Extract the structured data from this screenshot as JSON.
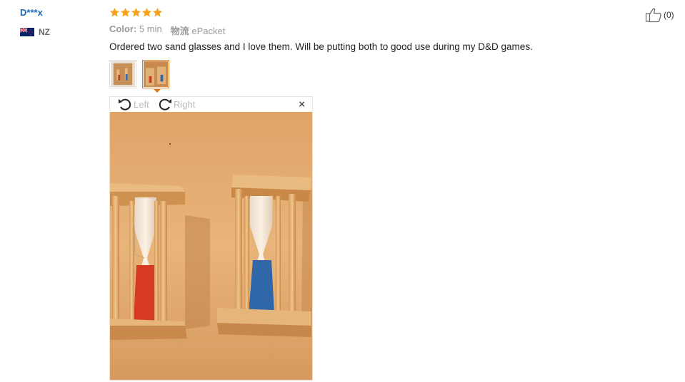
{
  "review": {
    "user_name": "D***x",
    "country_code": "NZ",
    "flag_icon": "new-zealand-flag-icon",
    "rating": 5,
    "star_color": "#f7a21b",
    "color_label": "Color:",
    "color_value": "5 min",
    "shipping_label": "物流",
    "shipping_value": "ePacket",
    "text": "Ordered two sand glasses and I love them. Will be putting both to good use during my D&D games.",
    "like_count": "(0)"
  },
  "viewer": {
    "rotate_left_label": "Left",
    "rotate_right_label": "Right",
    "close_label": "×",
    "active_thumbnail": 2
  },
  "colors": {
    "user_link": "#1a6ab5",
    "active_border": "#e07a1f"
  }
}
